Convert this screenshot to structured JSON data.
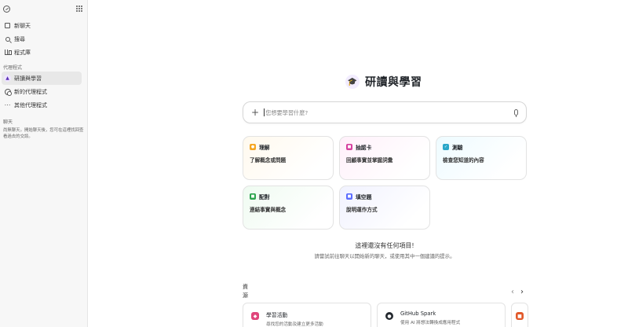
{
  "sidebar": {
    "nav": [
      {
        "label": "新聊天",
        "icon": "new-chat-icon"
      },
      {
        "label": "搜尋",
        "icon": "search-icon"
      },
      {
        "label": "程式庫",
        "icon": "library-icon"
      }
    ],
    "agents_heading": "代理程式",
    "agents": [
      {
        "label": "研讀與學習",
        "icon": "graduation-cap-icon",
        "active": true
      },
      {
        "label": "新的代理程式",
        "icon": "new-agent-icon"
      },
      {
        "label": "其他代理程式",
        "icon": "more-icon"
      }
    ],
    "chats_heading": "聊天",
    "chats_note": "尚無聊天。開始聊天後，您可在這裡找回查看過去的交談。"
  },
  "hero": {
    "title": "研讀與學習"
  },
  "composer": {
    "placeholder": "您想要學習什麼?"
  },
  "suggestions": [
    {
      "title": "理解",
      "desc": "了解概念或問題",
      "color": "#f5a623"
    },
    {
      "title": "抽認卡",
      "desc": "回顧事實並掌握詞彙",
      "color": "#d6409f"
    },
    {
      "title": "測驗",
      "desc": "檢查您知道的內容",
      "color": "#2aa7c9"
    },
    {
      "title": "配對",
      "desc": "連結事實與概念",
      "color": "#2da44e"
    },
    {
      "title": "填空題",
      "desc": "說明運作方式",
      "color": "#5b6cff"
    }
  ],
  "empty": {
    "title": "這裡還沒有任何項目!",
    "subtitle": "請嘗試前往聊天以開始新的聊天，或使用其中一個建議的提示。"
  },
  "resources": {
    "label": "資源",
    "items": [
      {
        "title": "學習活動",
        "desc": "尋找您的活動及建立更多活動",
        "icon": "activity-icon",
        "color": "#e0457b"
      },
      {
        "title": "GitHub Spark",
        "desc": "使用 AI 將想法轉換成應用程式",
        "icon": "github-icon",
        "color": "#24292f"
      }
    ]
  }
}
